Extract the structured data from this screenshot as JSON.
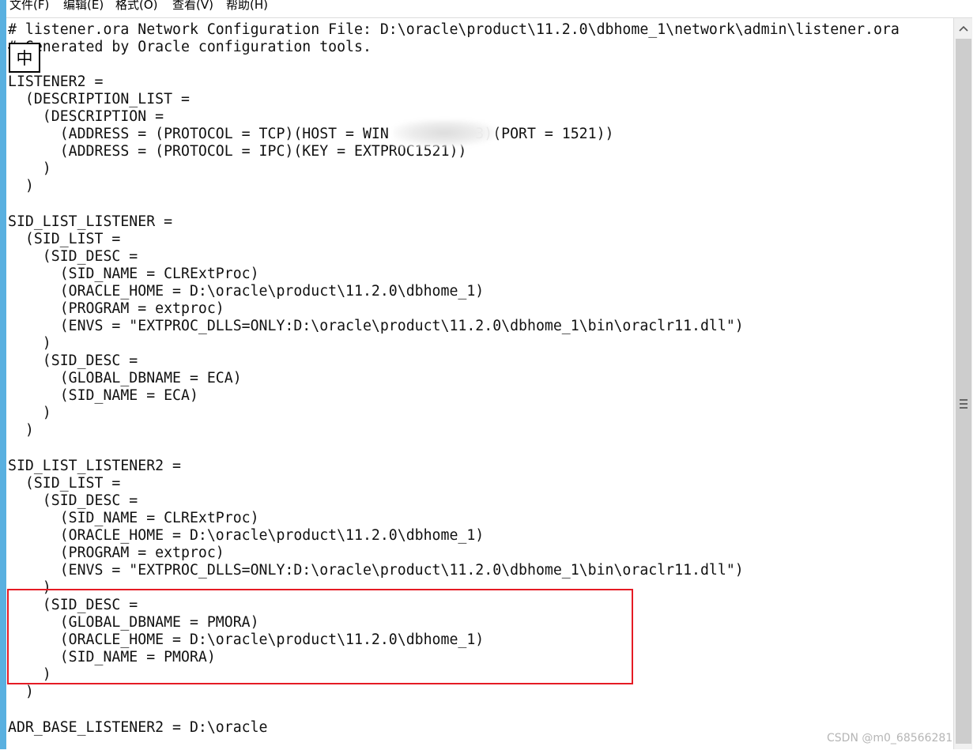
{
  "menu": [
    "文件(F)",
    "编辑(E)",
    "格式(O)",
    "查看(V)",
    "帮助(H)"
  ],
  "ime_indicator": "中",
  "lines": [
    "# listener.ora Network Configuration File: D:\\oracle\\product\\11.2.0\\dbhome_1\\network\\admin\\listener.ora",
    "# Generated by Oracle configuration tools.",
    "",
    "LISTENER2 =",
    "  (DESCRIPTION_LIST =",
    "    (DESCRIPTION =",
    "      (ADDRESS = (PROTOCOL = TCP)(HOST = WIN          3)(PORT = 1521))",
    "      (ADDRESS = (PROTOCOL = IPC)(KEY = EXTPROC1521))",
    "    )",
    "  )",
    "",
    "SID_LIST_LISTENER =",
    "  (SID_LIST =",
    "    (SID_DESC =",
    "      (SID_NAME = CLRExtProc)",
    "      (ORACLE_HOME = D:\\oracle\\product\\11.2.0\\dbhome_1)",
    "      (PROGRAM = extproc)",
    "      (ENVS = \"EXTPROC_DLLS=ONLY:D:\\oracle\\product\\11.2.0\\dbhome_1\\bin\\oraclr11.dll\")",
    "    )",
    "    (SID_DESC =",
    "      (GLOBAL_DBNAME = ECA)",
    "      (SID_NAME = ECA)",
    "    )",
    "  )",
    "",
    "SID_LIST_LISTENER2 =",
    "  (SID_LIST =",
    "    (SID_DESC =",
    "      (SID_NAME = CLRExtProc)",
    "      (ORACLE_HOME = D:\\oracle\\product\\11.2.0\\dbhome_1)",
    "      (PROGRAM = extproc)",
    "      (ENVS = \"EXTPROC_DLLS=ONLY:D:\\oracle\\product\\11.2.0\\dbhome_1\\bin\\oraclr11.dll\")",
    "    )",
    "    (SID_DESC =",
    "      (GLOBAL_DBNAME = PMORA)",
    "      (ORACLE_HOME = D:\\oracle\\product\\11.2.0\\dbhome_1)",
    "      (SID_NAME = PMORA)",
    "    )",
    "  )",
    "",
    "ADR_BASE_LISTENER2 = D:\\oracle"
  ],
  "watermark": "CSDN @m0_68566281",
  "colors": {
    "highlight": "#e51b24",
    "left_strip": "#59b0e0"
  }
}
